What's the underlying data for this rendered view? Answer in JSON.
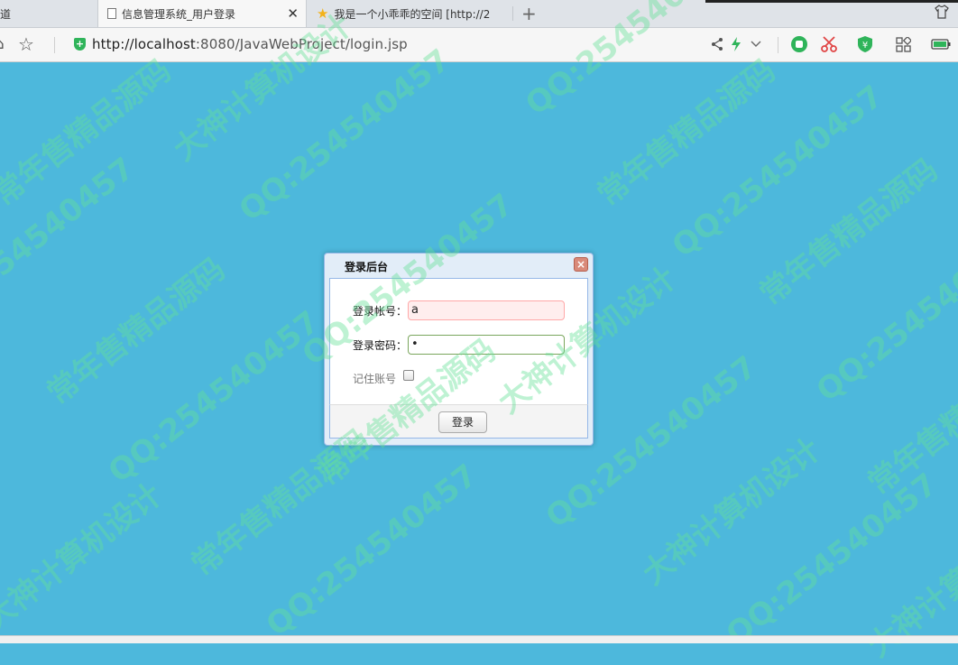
{
  "tabs": [
    {
      "label": "道"
    },
    {
      "label": "信息管理系统_用户登录",
      "active": true
    },
    {
      "label": "我是一个小乖乖的空间 [http://2"
    }
  ],
  "address_bar": {
    "url_host": "http://localhost",
    "url_rest": ":8080/JavaWebProject/login.jsp"
  },
  "dialog": {
    "title": "登录后台",
    "username_label": "登录帐号：",
    "username_value": "a",
    "password_label": "登录密码：",
    "password_mask": "•",
    "remember_label": "记住账号",
    "remember_checked": false,
    "submit_label": "登录"
  },
  "watermark": {
    "lines": [
      "QQ:25454045",
      "常年售精品源码",
      "大神计算机设计",
      "QQ:254540457"
    ]
  },
  "colors": {
    "page_background": "#4db8dc",
    "dialog_border": "#95b8e7",
    "username_field_error": "#ffeeee",
    "security_shield": "#2fb45a",
    "tab_favorite_star": "#f3b21b",
    "watermark_text": "#64e196"
  },
  "icons": {
    "tab_page": "document-icon",
    "tab_favorite": "star-icon",
    "tab_close": "close-icon",
    "new_tab": "plus-icon",
    "skin": "tshirt-icon",
    "home": "home-icon",
    "favorites": "star-outline-icon",
    "security": "shield-icon",
    "share": "share-icon",
    "speed": "lightning-icon",
    "dropdown": "chevron-down-icon",
    "browser_extension": "green-circle-icon",
    "screenshot": "scissors-icon",
    "wallet": "yen-shield-icon",
    "apps": "grid-icon",
    "battery": "battery-icon",
    "dialog_close": "close-icon",
    "remember_checkbox": "checkbox-icon"
  }
}
